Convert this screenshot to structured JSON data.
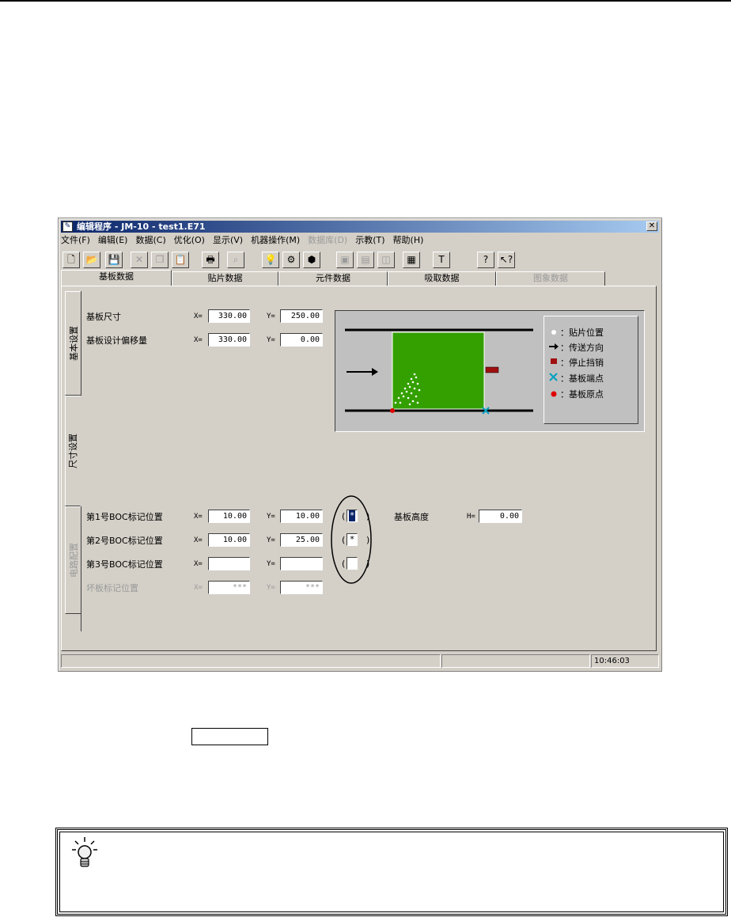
{
  "window": {
    "title": "编辑程序  - JM-10 - test1.E71",
    "close_glyph": "✕"
  },
  "menu": [
    "文件(F)",
    "编辑(E)",
    "数据(C)",
    "优化(O)",
    "显示(V)",
    "机器操作(M)",
    "数据库(D)",
    "示教(T)",
    "帮助(H)"
  ],
  "menu_disabled": [
    "数据库(D)"
  ],
  "toolbar": [
    {
      "icon": "new-file-icon",
      "glyph": "🗋"
    },
    {
      "icon": "open-folder-icon",
      "glyph": "📂"
    },
    {
      "icon": "save-icon",
      "glyph": "💾"
    },
    {
      "icon": "cut-icon",
      "glyph": "✕"
    },
    {
      "icon": "copy-icon",
      "glyph": "❐"
    },
    {
      "icon": "paste-icon",
      "glyph": "📋"
    },
    {
      "icon": "print-icon",
      "glyph": "🖶"
    },
    {
      "icon": "binoculars-icon",
      "glyph": "⌕"
    },
    {
      "icon": "lightbulb-icon",
      "glyph": "💡"
    },
    {
      "icon": "optimize-icon",
      "glyph": "⚙"
    },
    {
      "icon": "components-icon",
      "glyph": "⬢"
    },
    {
      "icon": "machine-icon",
      "glyph": "▣"
    },
    {
      "icon": "feeder-icon",
      "glyph": "▤"
    },
    {
      "icon": "package-icon",
      "glyph": "◫"
    },
    {
      "icon": "grid-icon",
      "glyph": "▦"
    },
    {
      "icon": "text-icon",
      "glyph": "T"
    },
    {
      "icon": "help-icon",
      "glyph": "?"
    },
    {
      "icon": "context-help-icon",
      "glyph": "↖?"
    }
  ],
  "tabs_top": [
    "基板数据",
    "贴片数据",
    "元件数据",
    "吸取数据",
    "图象数据"
  ],
  "tabs_side": [
    "基本设置",
    "尺寸设置",
    "电路配置"
  ],
  "board": {
    "size_label": "基板尺寸",
    "size_x_label": "X=",
    "size_x": "330.00",
    "size_y_label": "Y=",
    "size_y": "250.00",
    "offset_label": "基板设计偏移量",
    "offset_x_label": "X=",
    "offset_x": "330.00",
    "offset_y_label": "Y=",
    "offset_y": "0.00"
  },
  "legend": {
    "items": [
      "：贴片位置",
      "：传送方向",
      "：停止挡销",
      "：基板端点",
      "：基板原点"
    ],
    "colors": {
      "board": "#33a000",
      "stopper": "#a01010",
      "origin": "#e00000",
      "endpoint": "#00a0c0"
    }
  },
  "marks": [
    {
      "label": "第1号BOC标记位置",
      "x_label": "X=",
      "x": "10.00",
      "y_label": "Y=",
      "y": "10.00",
      "check": "*"
    },
    {
      "label": "第2号BOC标记位置",
      "x_label": "X=",
      "x": "10.00",
      "y_label": "Y=",
      "y": "25.00",
      "check": "*"
    },
    {
      "label": "第3号BOC标记位置",
      "x_label": "X=",
      "x": "",
      "y_label": "Y=",
      "y": "",
      "check": ""
    }
  ],
  "bad_mark": {
    "label": "坏板标记位置",
    "x_label": "X=",
    "x": "***",
    "y_label": "Y=",
    "y": "***"
  },
  "height": {
    "label": "基板高度",
    "h_label": "H=",
    "value": "0.00"
  },
  "paren_open": "(",
  "paren_close": ")",
  "status": {
    "time": "10:46:03"
  }
}
